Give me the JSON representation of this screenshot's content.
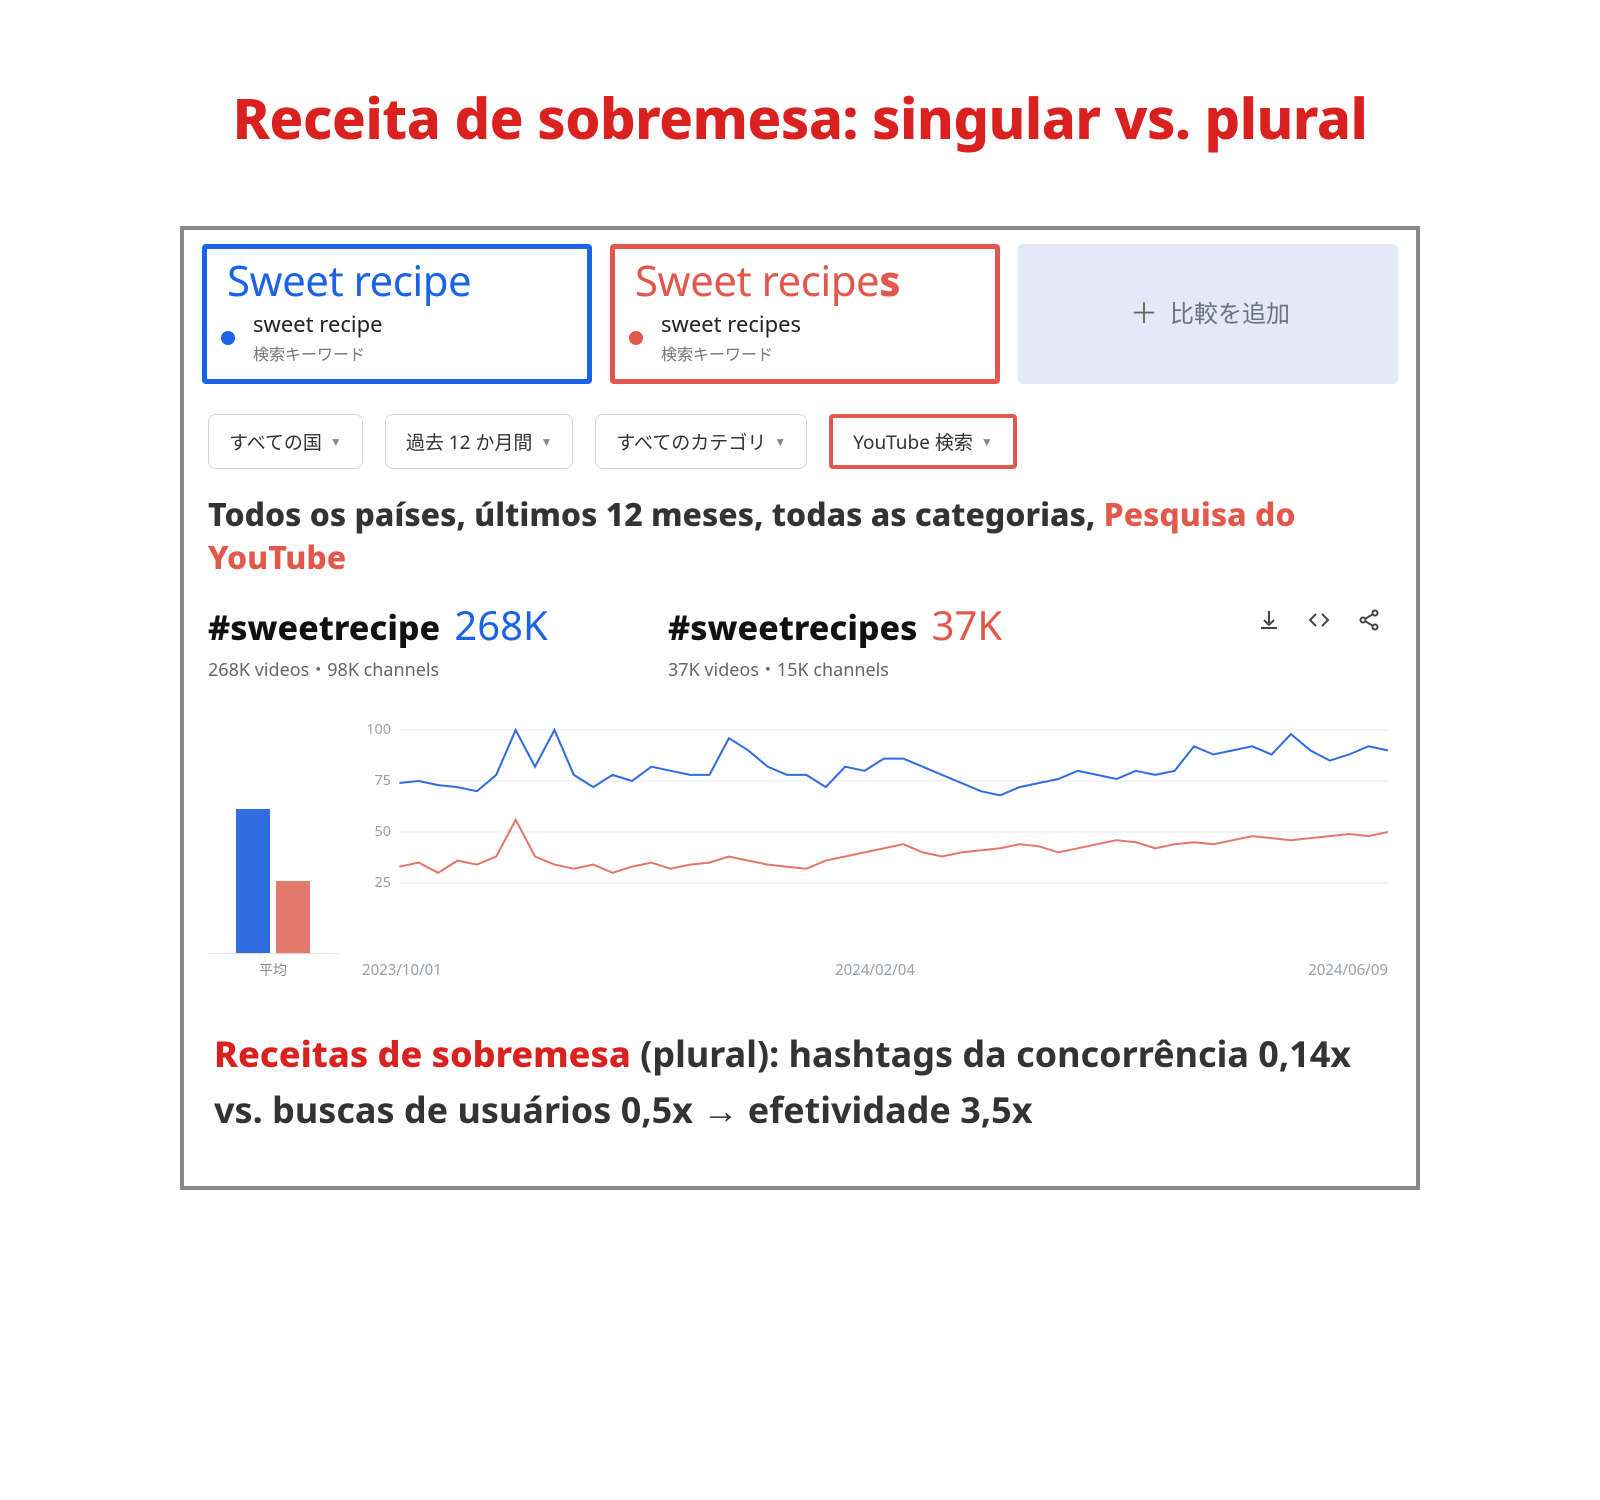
{
  "title": "Receita de sobremesa: singular vs. plural",
  "compare": {
    "term1_display": "Sweet recipe",
    "term1_keyword": "sweet recipe",
    "term1_type": "検索キーワード",
    "term2_display_base": "Sweet recipe",
    "term2_display_suffix": "s",
    "term2_keyword": "sweet recipes",
    "term2_type": "検索キーワード",
    "add_label": "比較を追加"
  },
  "filters": {
    "region": "すべての国",
    "range": "過去 12 か月間",
    "category": "すべてのカテゴリ",
    "source": "YouTube 検索"
  },
  "context_prefix": "Todos os países, últimos 12 meses, todas as categorias, ",
  "context_highlight": "Pesquisa do YouTube",
  "hashtags": {
    "tag1_name": "#sweetrecipe",
    "tag1_count": "268K",
    "tag1_sub": "268K videos・98K channels",
    "tag2_name": "#sweetrecipes",
    "tag2_count": "37K",
    "tag2_sub": "37K videos・15K channels"
  },
  "avg_label": "平均",
  "x_ticks": {
    "t1": "2023/10/01",
    "t2": "2024/02/04",
    "t3": "2024/06/09"
  },
  "conclusion_emph": "Receitas de sobremesa",
  "conclusion_rest": " (plural): hashtags da concorrência 0,14x vs. buscas de usuários 0,5x → efetividade 3,5x",
  "chart_data": {
    "type": "line",
    "title": "Interest over time — YouTube Search",
    "xlabel": "",
    "ylabel": "",
    "ylim": [
      0,
      100
    ],
    "y_ticks": [
      25,
      50,
      75,
      100
    ],
    "x_tick_labels": [
      "2023/10/01",
      "2024/02/04",
      "2024/06/09"
    ],
    "x": [
      0,
      1,
      2,
      3,
      4,
      5,
      6,
      7,
      8,
      9,
      10,
      11,
      12,
      13,
      14,
      15,
      16,
      17,
      18,
      19,
      20,
      21,
      22,
      23,
      24,
      25,
      26,
      27,
      28,
      29,
      30,
      31,
      32,
      33,
      34,
      35,
      36,
      37,
      38,
      39,
      40,
      41,
      42,
      43,
      44,
      45,
      46,
      47,
      48,
      49,
      50,
      51
    ],
    "series": [
      {
        "name": "sweet recipe",
        "color": "#2f6de0",
        "avg": 80,
        "values": [
          74,
          75,
          73,
          72,
          70,
          78,
          100,
          82,
          100,
          78,
          72,
          78,
          75,
          82,
          80,
          78,
          78,
          96,
          90,
          82,
          78,
          78,
          72,
          82,
          80,
          86,
          86,
          82,
          78,
          74,
          70,
          68,
          72,
          74,
          76,
          80,
          78,
          76,
          80,
          78,
          80,
          92,
          88,
          90,
          92,
          88,
          98,
          90,
          85,
          88,
          92,
          90
        ]
      },
      {
        "name": "sweet recipes",
        "color": "#e2776b",
        "avg": 40,
        "values": [
          33,
          35,
          30,
          36,
          34,
          38,
          56,
          38,
          34,
          32,
          34,
          30,
          33,
          35,
          32,
          34,
          35,
          38,
          36,
          34,
          33,
          32,
          36,
          38,
          40,
          42,
          44,
          40,
          38,
          40,
          41,
          42,
          44,
          43,
          40,
          42,
          44,
          46,
          45,
          42,
          44,
          45,
          44,
          46,
          48,
          47,
          46,
          47,
          48,
          49,
          48,
          50
        ]
      }
    ],
    "average_bars": {
      "type": "bar",
      "categories": [
        "sweet recipe",
        "sweet recipes"
      ],
      "values": [
        80,
        40
      ]
    }
  }
}
